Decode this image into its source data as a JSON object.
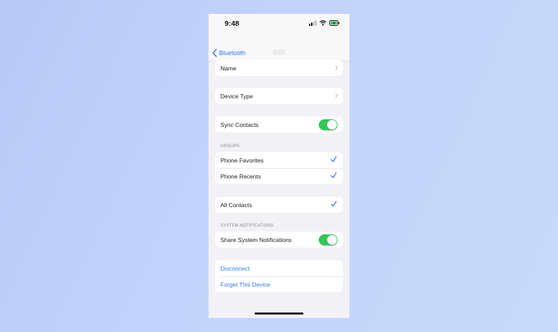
{
  "status_bar": {
    "time": "9:48"
  },
  "nav": {
    "back_label": "Bluetooth"
  },
  "rows": {
    "name": "Name",
    "device_type": "Device Type",
    "sync_contacts": "Sync Contacts",
    "phone_favorites": "Phone Favorites",
    "phone_recents": "Phone Recents",
    "all_contacts": "All Contacts",
    "share_system_notifications": "Share System Notifications",
    "disconnect": "Disconnect",
    "forget_device": "Forget This Device"
  },
  "sections": {
    "groups": "GROUPS",
    "system_notifications": "SYSTEM NOTIFICATIONS"
  },
  "toggles": {
    "sync_contacts": true,
    "share_system_notifications": true
  },
  "colors": {
    "accent_blue": "#2f7cf6",
    "toggle_green": "#34c759",
    "background": "#f1f1f6"
  },
  "icons": [
    "back-chevron-icon",
    "chevron-right-icon",
    "checkmark-icon",
    "signal-icon",
    "wifi-icon",
    "battery-icon"
  ]
}
